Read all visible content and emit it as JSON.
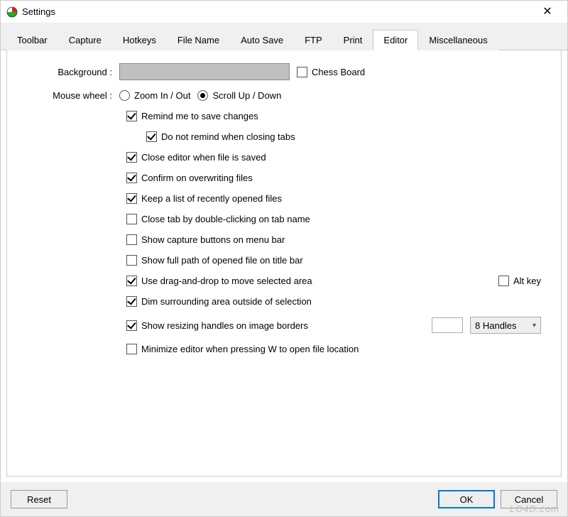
{
  "window": {
    "title": "Settings",
    "close_glyph": "✕"
  },
  "tabs": [
    {
      "label": "Toolbar"
    },
    {
      "label": "Capture"
    },
    {
      "label": "Hotkeys"
    },
    {
      "label": "File Name"
    },
    {
      "label": "Auto Save"
    },
    {
      "label": "FTP"
    },
    {
      "label": "Print"
    },
    {
      "label": "Editor"
    },
    {
      "label": "Miscellaneous"
    }
  ],
  "active_tab": "Editor",
  "editor": {
    "background_label": "Background :",
    "chess_board_label": "Chess Board",
    "chess_board_checked": false,
    "mouse_wheel_label": "Mouse wheel :",
    "mouse_wheel_zoom_label": "Zoom In / Out",
    "mouse_wheel_scroll_label": "Scroll Up / Down",
    "mouse_wheel_value": "scroll",
    "remind_save_label": "Remind me to save changes",
    "remind_save_checked": true,
    "no_remind_tabs_label": "Do not remind when closing tabs",
    "no_remind_tabs_checked": true,
    "close_on_save_label": "Close editor when file is saved",
    "close_on_save_checked": true,
    "confirm_overwrite_label": "Confirm on overwriting files",
    "confirm_overwrite_checked": true,
    "keep_recent_label": "Keep a list of recently opened files",
    "keep_recent_checked": true,
    "close_tab_dblclick_label": "Close tab by double-clicking on tab name",
    "close_tab_dblclick_checked": false,
    "show_capture_buttons_label": "Show capture buttons on menu bar",
    "show_capture_buttons_checked": false,
    "show_full_path_label": "Show full path of opened file on title bar",
    "show_full_path_checked": false,
    "use_drag_drop_label": "Use drag-and-drop to move selected area",
    "use_drag_drop_checked": true,
    "alt_key_label": "Alt key",
    "alt_key_checked": false,
    "dim_surrounding_label": "Dim surrounding area outside of selection",
    "dim_surrounding_checked": true,
    "show_resizing_handles_label": "Show resizing handles on image borders",
    "show_resizing_handles_checked": true,
    "handles_input_value": "",
    "handles_combo_value": "8 Handles",
    "minimize_editor_label": "Minimize editor when pressing W to open file location",
    "minimize_editor_checked": false
  },
  "buttons": {
    "reset": "Reset",
    "ok": "OK",
    "cancel": "Cancel"
  },
  "watermark": "LO4D.com"
}
